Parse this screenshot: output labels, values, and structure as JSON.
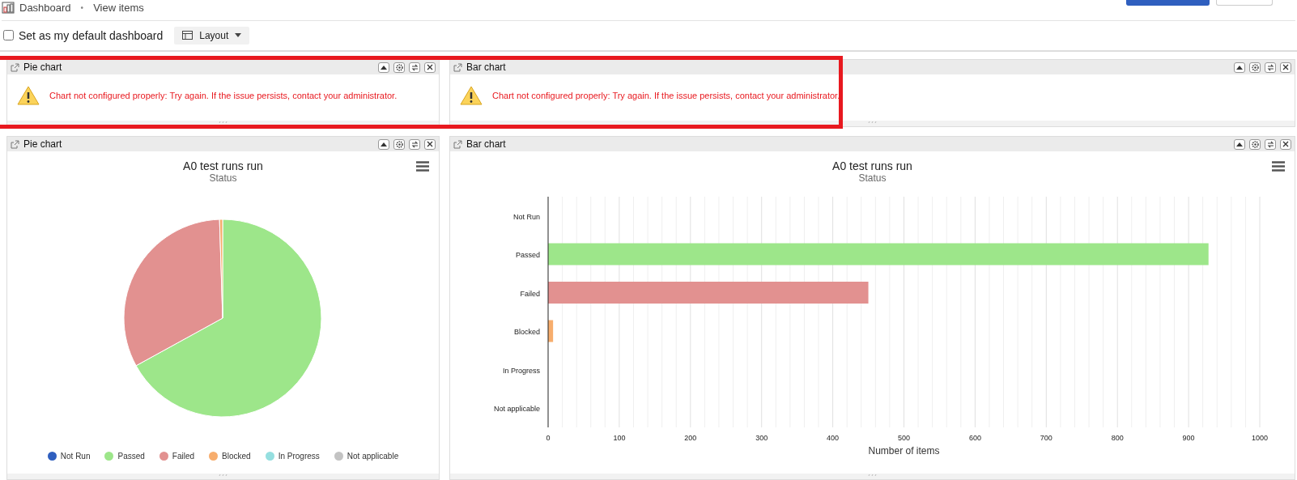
{
  "breadcrumb": {
    "title": "Dashboard",
    "separator": "•",
    "current": "View items"
  },
  "header_buttons": [
    {
      "kind": "primary"
    },
    {
      "kind": "secondary"
    }
  ],
  "default_dashboard": {
    "label": "Set as my default dashboard",
    "checked": false
  },
  "layout_button": {
    "label": "Layout"
  },
  "highlight": {
    "visible": true
  },
  "error_widgets": [
    {
      "title": "Pie chart",
      "message": "Chart not configured properly: Try again. If the issue persists, contact your administrator."
    },
    {
      "title": "Bar chart",
      "message": "Chart not configured properly: Try again. If the issue persists, contact your administrator."
    }
  ],
  "chart_widgets": [
    {
      "title": "Pie chart",
      "subtitle": "Status",
      "chart_data": {
        "type": "pie",
        "title": "A0 test runs run",
        "categories": [
          "Not Run",
          "Passed",
          "Failed",
          "Blocked",
          "In Progress",
          "Not applicable"
        ],
        "values": [
          0,
          67,
          32.5,
          0.5,
          0,
          0
        ],
        "colors": [
          "#2f5fbf",
          "#9de68a",
          "#e29190",
          "#f7ad6d",
          "#95dfe0",
          "#c3c3c3"
        ]
      }
    },
    {
      "title": "Bar chart",
      "subtitle": "Status",
      "chart_data": {
        "type": "bar",
        "orientation": "horizontal",
        "title": "A0 test runs run",
        "xlabel": "Number of items",
        "categories": [
          "Not Run",
          "Passed",
          "Failed",
          "Blocked",
          "In Progress",
          "Not applicable"
        ],
        "values": [
          0,
          928,
          450,
          7,
          0,
          0
        ],
        "colors": [
          null,
          "#9de68a",
          "#e29190",
          "#f7ad6d",
          null,
          null
        ],
        "grid": true,
        "xlim": [
          0,
          1000
        ],
        "xticks": [
          0,
          100,
          200,
          300,
          400,
          500,
          600,
          700,
          800,
          900,
          1000
        ]
      }
    }
  ]
}
